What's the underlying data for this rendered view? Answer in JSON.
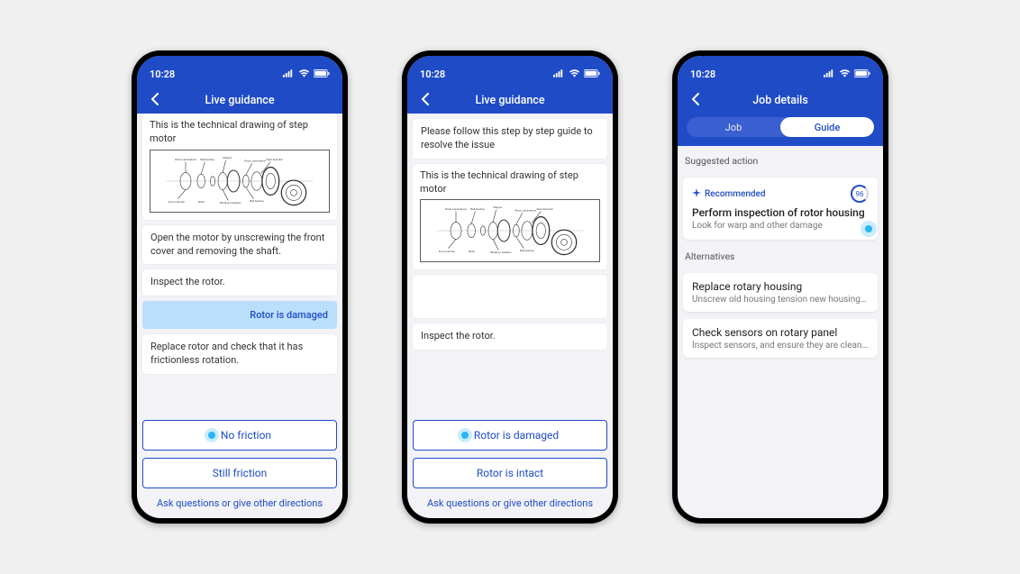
{
  "status": {
    "time": "10:28"
  },
  "phone1": {
    "title": "Live guidance",
    "drawing_text": "This is the technical drawing of step motor",
    "step1": "Open the motor by unscrewing the front cover and removing the shaft.",
    "step2": "Inspect the rotor.",
    "response": "Rotor is damaged",
    "step3": "Replace rotor and check that it has frictionless rotation.",
    "options": [
      "No friction",
      "Still friction"
    ],
    "footer": "Ask questions or give other directions"
  },
  "phone2": {
    "title": "Live guidance",
    "intro": "Please follow this step by step guide to resolve the issue",
    "drawing_text": "This is the technical drawing of step motor",
    "step": "Inspect the rotor.",
    "options": [
      "Rotor is damaged",
      "Rotor is intact"
    ],
    "footer": "Ask questions or give other directions"
  },
  "phone3": {
    "title": "Job details",
    "tabs": [
      "Job",
      "Guide"
    ],
    "active_tab": 1,
    "section1": "Suggested action",
    "recommended": {
      "label": "Recommended",
      "score": "96",
      "title": "Perform inspection of rotor housing",
      "sub": "Look for warp and other damage"
    },
    "section2": "Alternatives",
    "alts": [
      {
        "title": "Replace rotary housing",
        "sub": "Unscrew old housing tension new housing tor..."
      },
      {
        "title": "Check sensors on rotary panel",
        "sub": "Inspect sensors, and ensure they are cleaned o..."
      }
    ]
  }
}
